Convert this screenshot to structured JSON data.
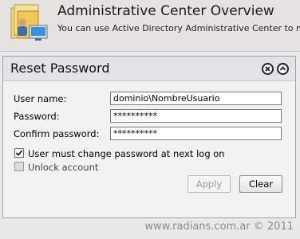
{
  "banner": {
    "title": "Administrative Center Overview",
    "subtitle": "You can use Active Directory Administrative Center to mar",
    "icon": "folder-users-icon"
  },
  "dialog": {
    "title": "Reset Password",
    "close_icon": "close-circle-icon",
    "collapse_icon": "chevron-up-circle-icon",
    "fields": {
      "username_label": "User name:",
      "username_value": "dominio\\NombreUsuario",
      "password_label": "Password:",
      "password_value": "**********",
      "confirm_label": "Confirm password:",
      "confirm_value": "**********"
    },
    "options": {
      "must_change_label": "User must change password at next log on",
      "must_change_checked": true,
      "unlock_label": "Unlock account",
      "unlock_checked": false
    },
    "buttons": {
      "apply_label": "Apply",
      "clear_label": "Clear"
    }
  },
  "watermark": "www.radians.com.ar © 2011",
  "colors": {
    "panel_header": "#e1e3e6",
    "panel_border": "#9ea3aa",
    "banner_bg": "#e4e3e0"
  }
}
